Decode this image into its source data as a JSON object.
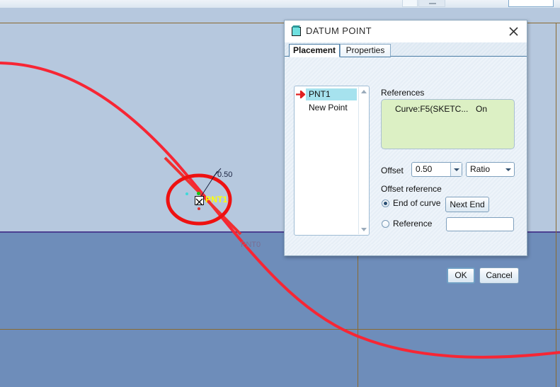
{
  "toolbar": {
    "name": "cropped-toolbar-strip"
  },
  "viewport": {
    "background_upper": "#b6c8de",
    "background_lower": "#6e8dba",
    "curve_color": "#f72634",
    "axis_color": "#8a6a30",
    "divider_color": "#4b3f91",
    "point_label": "PNT1",
    "dimension_label": "0.50",
    "origin_point_label": "PNT0",
    "annotation_circle_color": "#ee1111",
    "annotation_slash_color": "#f03030",
    "point_label_color": "#ffff00",
    "origin_label_color": "#7a6f94"
  },
  "dialog": {
    "title": "DATUM POINT",
    "icon": "datum-plane-icon",
    "close_label": "✕",
    "tabs": [
      {
        "label": "Placement",
        "active": true
      },
      {
        "label": "Properties",
        "active": false
      }
    ],
    "tree": {
      "items": [
        {
          "label": "PNT1",
          "selected": true,
          "icon": "datum-point-icon"
        },
        {
          "label": "New Point",
          "selected": false,
          "icon": ""
        }
      ]
    },
    "references": {
      "group_label": "References",
      "rows": [
        {
          "name": "Curve:F5(SKETC...",
          "state": "On"
        }
      ],
      "box_color": "#dcf0c4"
    },
    "offset": {
      "label": "Offset",
      "value": "0.50",
      "unit_value": "Ratio"
    },
    "offset_reference": {
      "group_label": "Offset reference",
      "options": [
        {
          "label": "End of curve",
          "checked": true
        },
        {
          "label": "Reference",
          "checked": false
        }
      ],
      "next_end_label": "Next End",
      "reference_input_value": "",
      "reference_input_placeholder": ""
    },
    "buttons": {
      "ok_label": "OK",
      "cancel_label": "Cancel"
    }
  }
}
